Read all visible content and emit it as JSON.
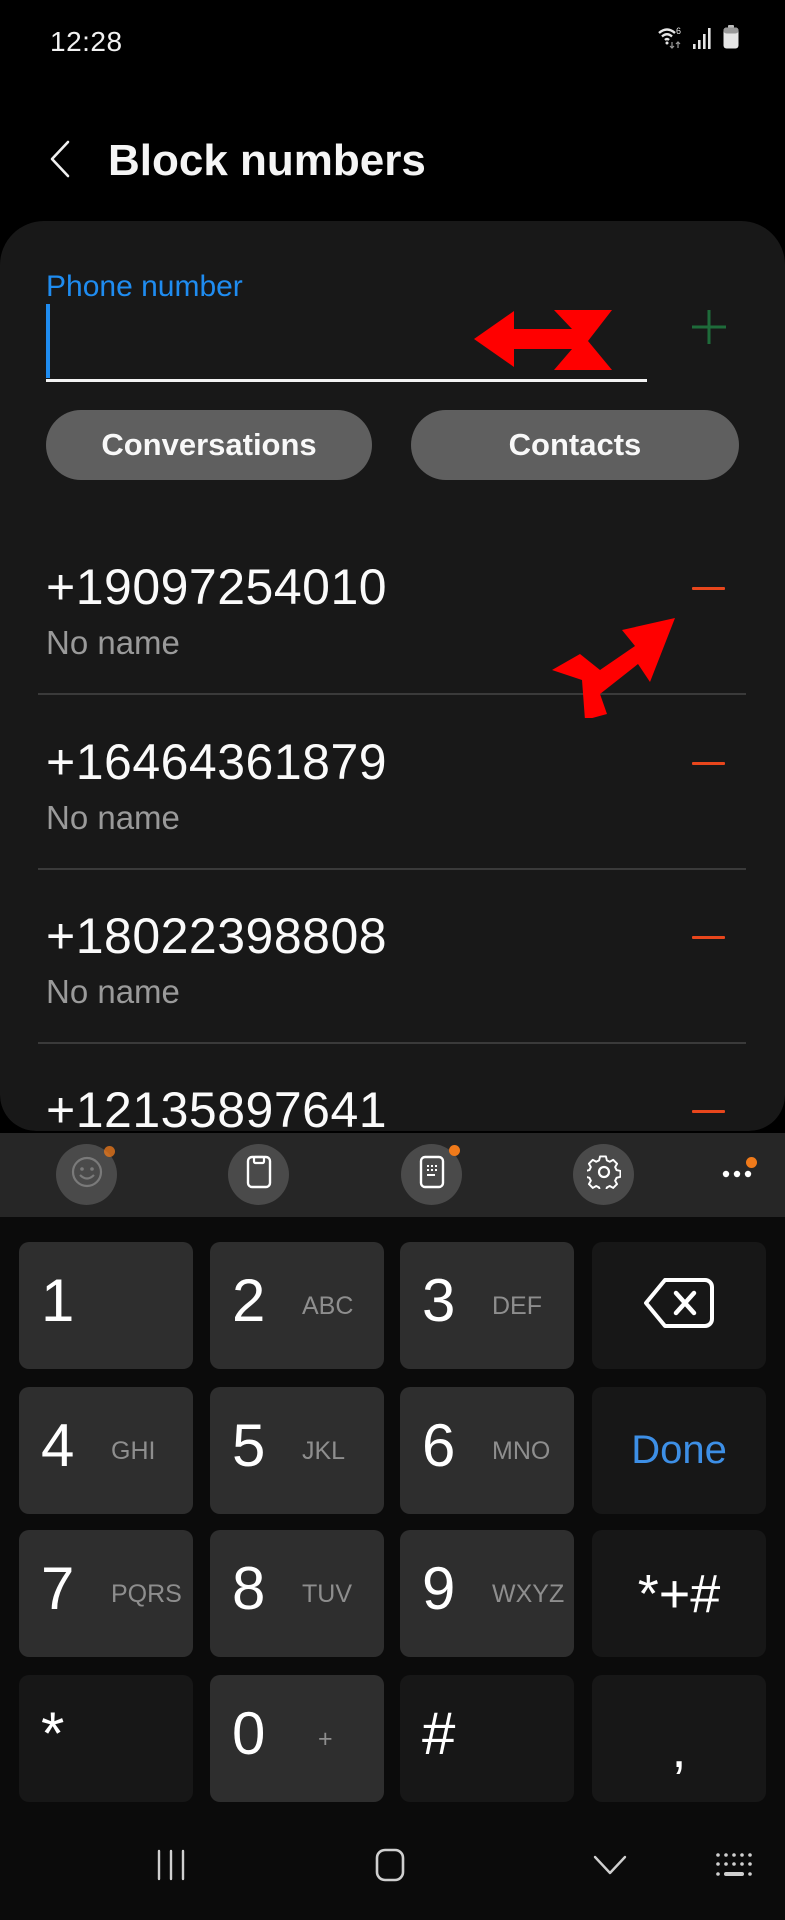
{
  "status_bar": {
    "time": "12:28",
    "icons": [
      "wifi-6-icon",
      "signal-icon",
      "battery-icon"
    ]
  },
  "header": {
    "back_icon": "chevron-left-icon",
    "title": "Block numbers"
  },
  "form": {
    "field_label": "Phone number",
    "field_value": "",
    "field_placeholder": "",
    "add_icon": "plus-icon",
    "add_color": "#1e6b3a",
    "buttons": {
      "conversations": "Conversations",
      "contacts": "Contacts"
    }
  },
  "blocked_list": [
    {
      "number": "+19097254010",
      "name": "No name"
    },
    {
      "number": "+16464361879",
      "name": "No name"
    },
    {
      "number": "+18022398808",
      "name": "No name"
    },
    {
      "number": "+12135897641",
      "name": ""
    }
  ],
  "colors": {
    "accent_blue": "#1f8cf0",
    "remove_red": "#e8461c",
    "annotation_red": "#ff0000",
    "notification_orange": "#f07a1a",
    "done_blue": "#3d8fe6"
  },
  "keyboard_toolbar": {
    "items": [
      "emoji-icon",
      "clipboard-icon",
      "keyboard-mode-icon",
      "settings-icon",
      "more-icon"
    ]
  },
  "keypad": {
    "rows": [
      [
        {
          "digit": "1",
          "letters": ""
        },
        {
          "digit": "2",
          "letters": "ABC"
        },
        {
          "digit": "3",
          "letters": "DEF"
        },
        {
          "label": "backspace"
        }
      ],
      [
        {
          "digit": "4",
          "letters": "GHI"
        },
        {
          "digit": "5",
          "letters": "JKL"
        },
        {
          "digit": "6",
          "letters": "MNO"
        },
        {
          "label": "Done"
        }
      ],
      [
        {
          "digit": "7",
          "letters": "PQRS"
        },
        {
          "digit": "8",
          "letters": "TUV"
        },
        {
          "digit": "9",
          "letters": "WXYZ"
        },
        {
          "label": "*+#"
        }
      ],
      [
        {
          "digit": "*",
          "letters": ""
        },
        {
          "digit": "0",
          "letters": "+"
        },
        {
          "digit": "#",
          "letters": ""
        },
        {
          "label": ","
        }
      ]
    ]
  },
  "nav_bar": {
    "items": [
      "recents-icon",
      "home-icon",
      "back-chevron-icon",
      "keyboard-switch-icon"
    ]
  }
}
